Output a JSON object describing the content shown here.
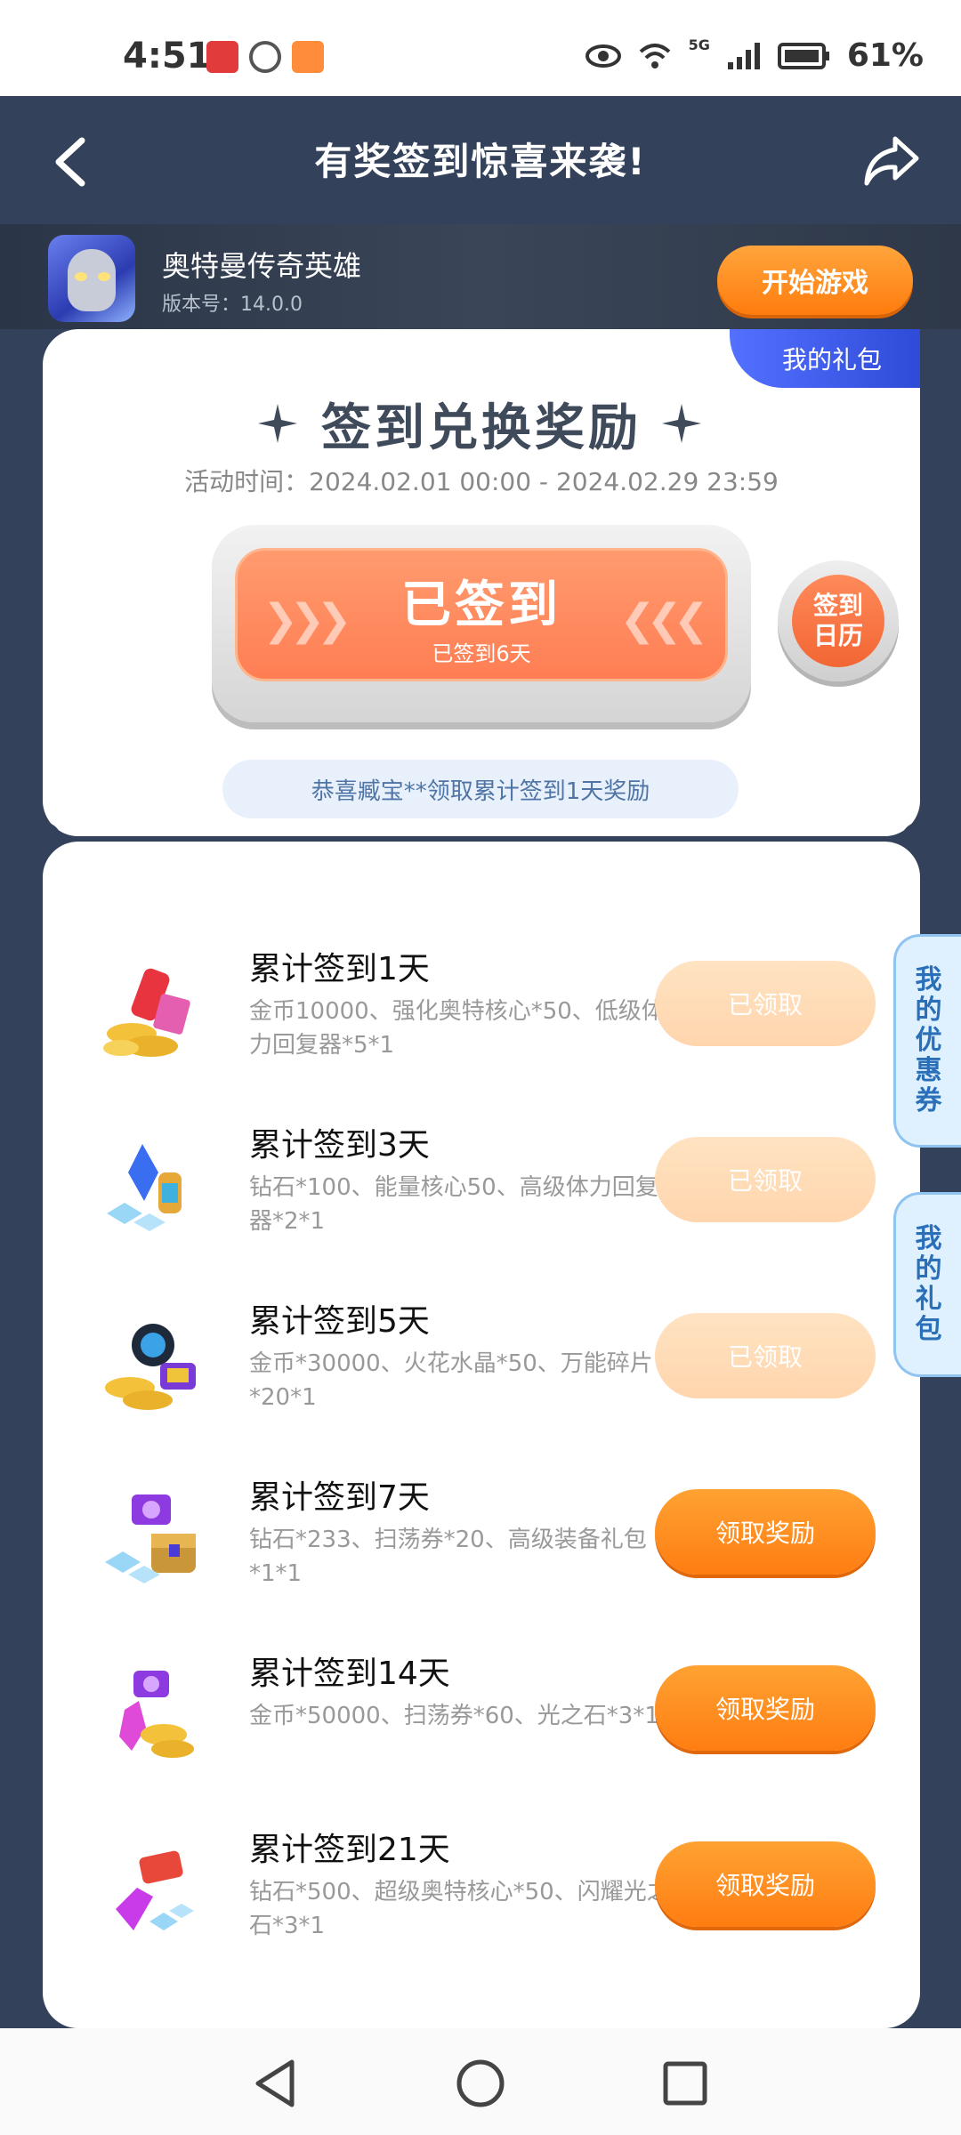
{
  "status_bar": {
    "time": "4:51",
    "battery": "61%",
    "network": "5G"
  },
  "header": {
    "title": "有奖签到惊喜来袭!"
  },
  "game": {
    "name": "奥特曼传奇英雄",
    "version": "版本号：14.0.0",
    "start_label": "开始游戏"
  },
  "card": {
    "my_gift_tab": "我的礼包",
    "heading": "签到兑换奖励",
    "activity_time": "活动时间：2024.02.01 00:00 - 2024.02.29 23:59",
    "checkin_main": "已签到",
    "checkin_sub": "已签到6天",
    "calendar_label_1": "签到",
    "calendar_label_2": "日历",
    "congrats": "恭喜臧宝**领取累计签到1天奖励"
  },
  "rewards": [
    {
      "title": "累计签到1天",
      "desc": "金币10000、强化奥特核心*50、低级体力回复器*5*1",
      "button": "已领取",
      "state": "claimed"
    },
    {
      "title": "累计签到3天",
      "desc": "钻石*100、能量核心50、高级体力回复器*2*1",
      "button": "已领取",
      "state": "claimed"
    },
    {
      "title": "累计签到5天",
      "desc": "金币*30000、火花水晶*50、万能碎片*20*1",
      "button": "已领取",
      "state": "claimed"
    },
    {
      "title": "累计签到7天",
      "desc": "钻石*233、扫荡券*20、高级装备礼包*1*1",
      "button": "领取奖励",
      "state": "available"
    },
    {
      "title": "累计签到14天",
      "desc": "金币*50000、扫荡券*60、光之石*3*1",
      "button": "领取奖励",
      "state": "available"
    },
    {
      "title": "累计签到21天",
      "desc": "钻石*500、超级奥特核心*50、闪耀光之石*3*1",
      "button": "领取奖励",
      "state": "available"
    }
  ],
  "side_tabs": {
    "coupons": "我的优惠券",
    "gifts": "我的礼包"
  },
  "icons": {
    "back": "back-arrow-icon",
    "share": "share-icon",
    "calendar": "calendar-icon",
    "nav_back": "triangle-back-icon",
    "nav_home": "circle-home-icon",
    "nav_recent": "square-recents-icon"
  },
  "colors": {
    "header_bg": "#33425a",
    "accent_orange": "#ff8a1f",
    "claimed_peach": "#ffd9b5",
    "tab_blue": "#3f5df0"
  }
}
